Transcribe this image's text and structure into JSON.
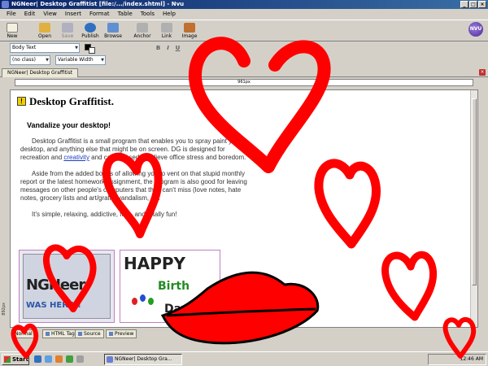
{
  "window": {
    "title": "NGNeer| Desktop Graffitist [file:/.../index.shtml] - Nvu"
  },
  "menu": [
    "File",
    "Edit",
    "View",
    "Insert",
    "Format",
    "Table",
    "Tools",
    "Help"
  ],
  "toolbar": {
    "items": [
      {
        "label": "New",
        "icon": "new-doc-icon",
        "color": "#f4f0e0"
      },
      {
        "label": "Open",
        "icon": "folder-icon",
        "color": "#e0b040"
      },
      {
        "label": "Save",
        "icon": "save-icon",
        "color": "#9090b0"
      },
      {
        "label": "Publish",
        "icon": "globe-icon",
        "color": "#3070c0"
      },
      {
        "label": "Browse",
        "icon": "browse-icon",
        "color": "#6090d0"
      },
      {
        "label": "Anchor",
        "icon": "anchor-icon",
        "color": "#707070"
      },
      {
        "label": "Link",
        "icon": "link-icon",
        "color": "#707070"
      },
      {
        "label": "Image",
        "icon": "image-icon",
        "color": "#c07030"
      }
    ]
  },
  "format": {
    "paragraph_style": "Body Text",
    "class_style": "(no class)",
    "width_style": "Variable Width",
    "bold": "B",
    "italic": "I",
    "underline": "U"
  },
  "tabs": {
    "document": "NGNeer| Desktop Graffitist"
  },
  "ruler": {
    "width_readout": "961px",
    "height_readout": "892px"
  },
  "page": {
    "heading": "Desktop Graffitist.",
    "heading_icon": "!",
    "subheading": "Vandalize your desktop!",
    "para1_a": "Desktop Graffitist is a small program that enables you to spray paint your desktop, and anything else that might be on screen. DG is designed for recreation and ",
    "para1_link": "creativity",
    "para1_b": " and can be used to relieve office stress and boredom.",
    "para2": "Aside from the added bonus of allowing you to vent on that stupid monthly report or the latest homework assignment, the program is also good for leaving messages on other people's computers that they can't miss (love notes, hate notes, grocery lists and art/graffiti/vandalism, ...).",
    "para3": "It's simple, relaxing, addictive, free, and totally fun!",
    "thumb1_text1": "NGNeer",
    "thumb1_text2": "WAS HERE!!",
    "thumb2_text1": "HAPPY",
    "thumb2_text2": "Birth",
    "thumb2_text3": "Day"
  },
  "edit_modes": [
    "Normal",
    "HTML Tags",
    "Source",
    "Preview"
  ],
  "taskbar": {
    "start": "Start",
    "task": "NGNeer| Desktop Gra...",
    "clock": "12:46 AM"
  },
  "colors": {
    "graffiti": "#ff0000",
    "titlebar": "#0a246a",
    "link": "#2040c0"
  }
}
